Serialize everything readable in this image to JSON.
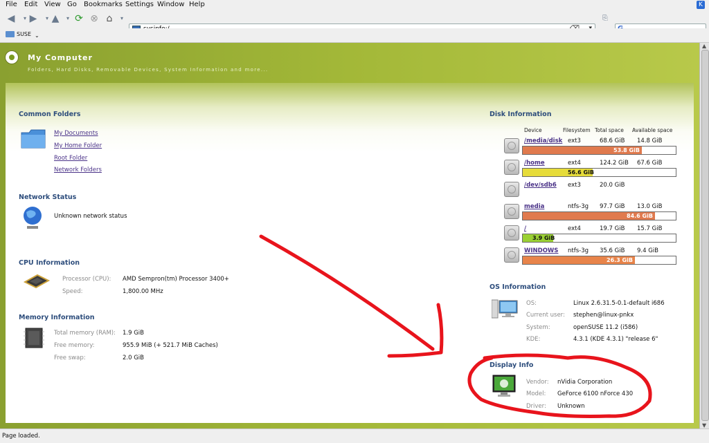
{
  "menu": [
    "File",
    "Edit",
    "View",
    "Go",
    "Bookmarks",
    "Settings",
    "Window",
    "Help"
  ],
  "toolbar": {
    "url": "sysinfo:/"
  },
  "bookmarks": {
    "label": "SUSE"
  },
  "header": {
    "title": "My Computer",
    "subtitle": "Folders, Hard Disks, Removable Devices, System Information and more..."
  },
  "common_folders": {
    "title": "Common Folders",
    "links": [
      "My Documents",
      "My Home Folder",
      "Root Folder",
      "Network Folders"
    ]
  },
  "network": {
    "title": "Network Status",
    "status": "Unknown network status"
  },
  "cpu": {
    "title": "CPU Information",
    "rows": [
      {
        "k": "Processor (CPU):",
        "v": "AMD Sempron(tm) Processor 3400+"
      },
      {
        "k": "Speed:",
        "v": "1,800.00 MHz"
      }
    ]
  },
  "memory": {
    "title": "Memory Information",
    "rows": [
      {
        "k": "Total memory (RAM):",
        "v": "1.9 GiB"
      },
      {
        "k": "Free memory:",
        "v": "955.9 MiB (+ 521.7 MiB Caches)"
      },
      {
        "k": "Free swap:",
        "v": "2.0 GiB"
      }
    ]
  },
  "disk": {
    "title": "Disk Information",
    "headers": [
      "Device",
      "Filesystem",
      "Total space",
      "Available space"
    ],
    "rows": [
      {
        "device": "/media/disk",
        "fs": "ext3",
        "total": "68.6 GiB",
        "avail": "14.8 GiB",
        "used": "53.8 GiB",
        "fraction": 0.78,
        "color": "#e07a4e"
      },
      {
        "device": "/home",
        "fs": "ext4",
        "total": "124.2 GiB",
        "avail": "67.6 GiB",
        "used": "56.6 GiB",
        "fraction": 0.455,
        "color": "#e6dc3a"
      },
      {
        "device": "/dev/sdb6",
        "fs": "ext3",
        "total": "20.0 GiB",
        "avail": "",
        "used": "",
        "fraction": 0,
        "color": "#ffffff"
      },
      {
        "device": "media",
        "fs": "ntfs-3g",
        "total": "97.7 GiB",
        "avail": "13.0 GiB",
        "used": "84.6 GiB",
        "fraction": 0.865,
        "color": "#e07a4e"
      },
      {
        "device": "/",
        "fs": "ext4",
        "total": "19.7 GiB",
        "avail": "15.7 GiB",
        "used": "3.9 GiB",
        "fraction": 0.2,
        "color": "#9ad034"
      },
      {
        "device": "WINDOWS",
        "fs": "ntfs-3g",
        "total": "35.6 GiB",
        "avail": "9.4 GiB",
        "used": "26.3 GiB",
        "fraction": 0.735,
        "color": "#e8844a"
      }
    ]
  },
  "os": {
    "title": "OS Information",
    "rows": [
      {
        "k": "OS:",
        "v": "Linux 2.6.31.5-0.1-default i686"
      },
      {
        "k": "Current user:",
        "v": "stephen@linux-pnkx"
      },
      {
        "k": "System:",
        "v": "openSUSE 11.2 (i586)"
      },
      {
        "k": "KDE:",
        "v": "4.3.1 (KDE 4.3.1) \"release 6\""
      }
    ]
  },
  "display": {
    "title": "Display Info",
    "rows": [
      {
        "k": "Vendor:",
        "v": "nVidia Corporation"
      },
      {
        "k": "Model:",
        "v": "GeForce 6100 nForce 430"
      },
      {
        "k": "Driver:",
        "v": "Unknown"
      }
    ]
  },
  "status": "Page loaded.",
  "annotation_color": "#e8141c"
}
